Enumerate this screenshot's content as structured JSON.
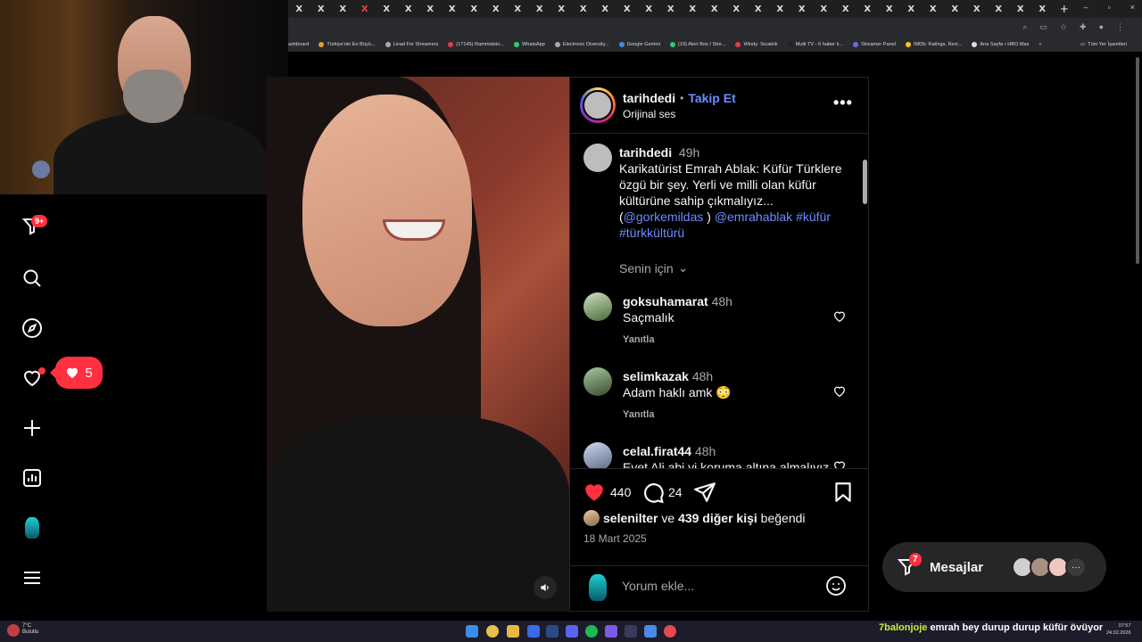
{
  "browser": {
    "tabs_count": 35,
    "tab_glyph": "X",
    "new_tab": "+",
    "window_controls": [
      "–",
      "▫",
      "×"
    ],
    "bookmarks": [
      "ashboard",
      "Türkiye'nin En Büyü...",
      "Livad For Streamers",
      "(17145) Rammstein...",
      "WhatsApp",
      "Electronic Diversity...",
      "Google Gemini",
      "(19) Alert Box / Stre...",
      "Windy: Sıcaklık",
      "Multi TV - 6 haber k...",
      "Streamer Panel",
      "IMDb: Ratings, Revi...",
      "Ana Sayfa • HBO Max"
    ],
    "bookmarks_more": "»",
    "all_bookmarks": "Tüm Yer İşaretleri"
  },
  "nav": {
    "notifications_badge": "9+",
    "likes_notification_count": "5"
  },
  "post": {
    "author": "tarihdedi",
    "follow_separator": "•",
    "follow_label": "Takip Et",
    "audio_label": "Orijinal ses",
    "more_label": "•••",
    "caption": {
      "author": "tarihdedi",
      "time": "49h",
      "text": "Karikatürist Emrah Ablak: Küfür Türklere özgü bir şey. Yerli ve milli olan küfür kültürüne sahip çıkmalıyız...",
      "mention1": "@gorkemildas",
      "paren_close": ")",
      "mention2": "@emrahablak",
      "tag1": "#küfür",
      "tag2": "#türkkültürü"
    },
    "filter_label": "Senin için",
    "comments": [
      {
        "user": "goksuhamarat",
        "time": "48h",
        "text": "Saçmalık",
        "reply": "Yanıtla"
      },
      {
        "user": "selimkazak",
        "time": "48h",
        "text": "Adam haklı amk 😳",
        "reply": "Yanıtla"
      },
      {
        "user": "celal.firat44",
        "time": "48h",
        "text": "Evet Ali abi yi koruma altına almalıyız"
      }
    ],
    "likes": "440",
    "comment_count": "24",
    "liked_by_user": "selenilter",
    "liked_by_mid": "ve",
    "liked_by_others": "439 diğer kişi",
    "liked_by_suffix": "beğendi",
    "date": "18 Mart 2025",
    "comment_placeholder": "Yorum ekle..."
  },
  "messages": {
    "label": "Mesajlar",
    "badge": "7",
    "more": "···"
  },
  "taskbar": {
    "weather_temp": "7°C",
    "weather_desc": "Bulutlu",
    "ticker_user": "7balonjoje",
    "ticker_message": "emrah bey durup durup küfür övüyor",
    "clock_time": "07:57",
    "clock_date": "24.02.2026"
  },
  "colors": {
    "accent_blue": "#6c8cff",
    "like_red": "#ff3040",
    "ticker_green": "#c8f03c"
  }
}
